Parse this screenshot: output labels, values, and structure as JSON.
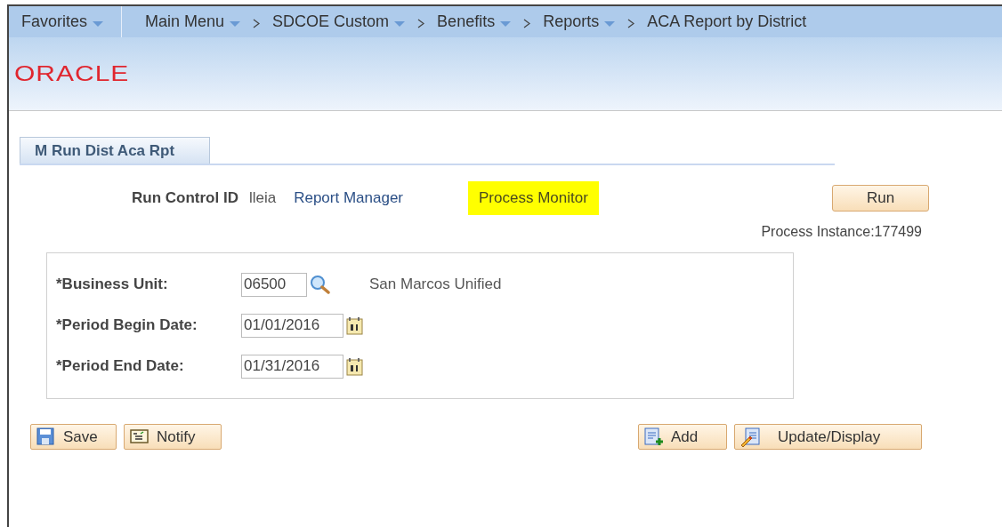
{
  "nav": {
    "favorites": {
      "label": "Favorites",
      "dropdown": true
    },
    "breadcrumbs": [
      {
        "label": "Main Menu",
        "dropdown": true
      },
      {
        "label": "SDCOE Custom",
        "dropdown": true
      },
      {
        "label": "Benefits",
        "dropdown": true
      },
      {
        "label": "Reports",
        "dropdown": true
      },
      {
        "label": "ACA Report by District",
        "dropdown": false
      }
    ]
  },
  "logo": "ORACLE",
  "tabs": [
    {
      "label": "M Run Dist Aca Rpt",
      "selected": true
    }
  ],
  "run_control": {
    "label": "Run Control ID",
    "value": "lleia",
    "links": [
      {
        "label": "Report Manager",
        "highlighted": false
      },
      {
        "label": "Process Monitor",
        "highlighted": true
      }
    ],
    "run_button": "Run",
    "process_instance": "Process Instance:177499"
  },
  "fields": [
    {
      "label": "*Business Unit:",
      "value": "06500",
      "kind": "lookup",
      "description": "San Marcos Unified"
    },
    {
      "label": "*Period Begin Date:",
      "value": "01/01/2016",
      "kind": "date"
    },
    {
      "label": "*Period End Date:",
      "value": "01/31/2016",
      "kind": "date"
    }
  ],
  "buttons_left": [
    {
      "label": "Save",
      "kind": "save"
    },
    {
      "label": "Notify",
      "kind": "notify"
    }
  ],
  "buttons_right": [
    {
      "label": "Add",
      "kind": "add"
    },
    {
      "label": "Update/Display",
      "kind": "update"
    }
  ]
}
